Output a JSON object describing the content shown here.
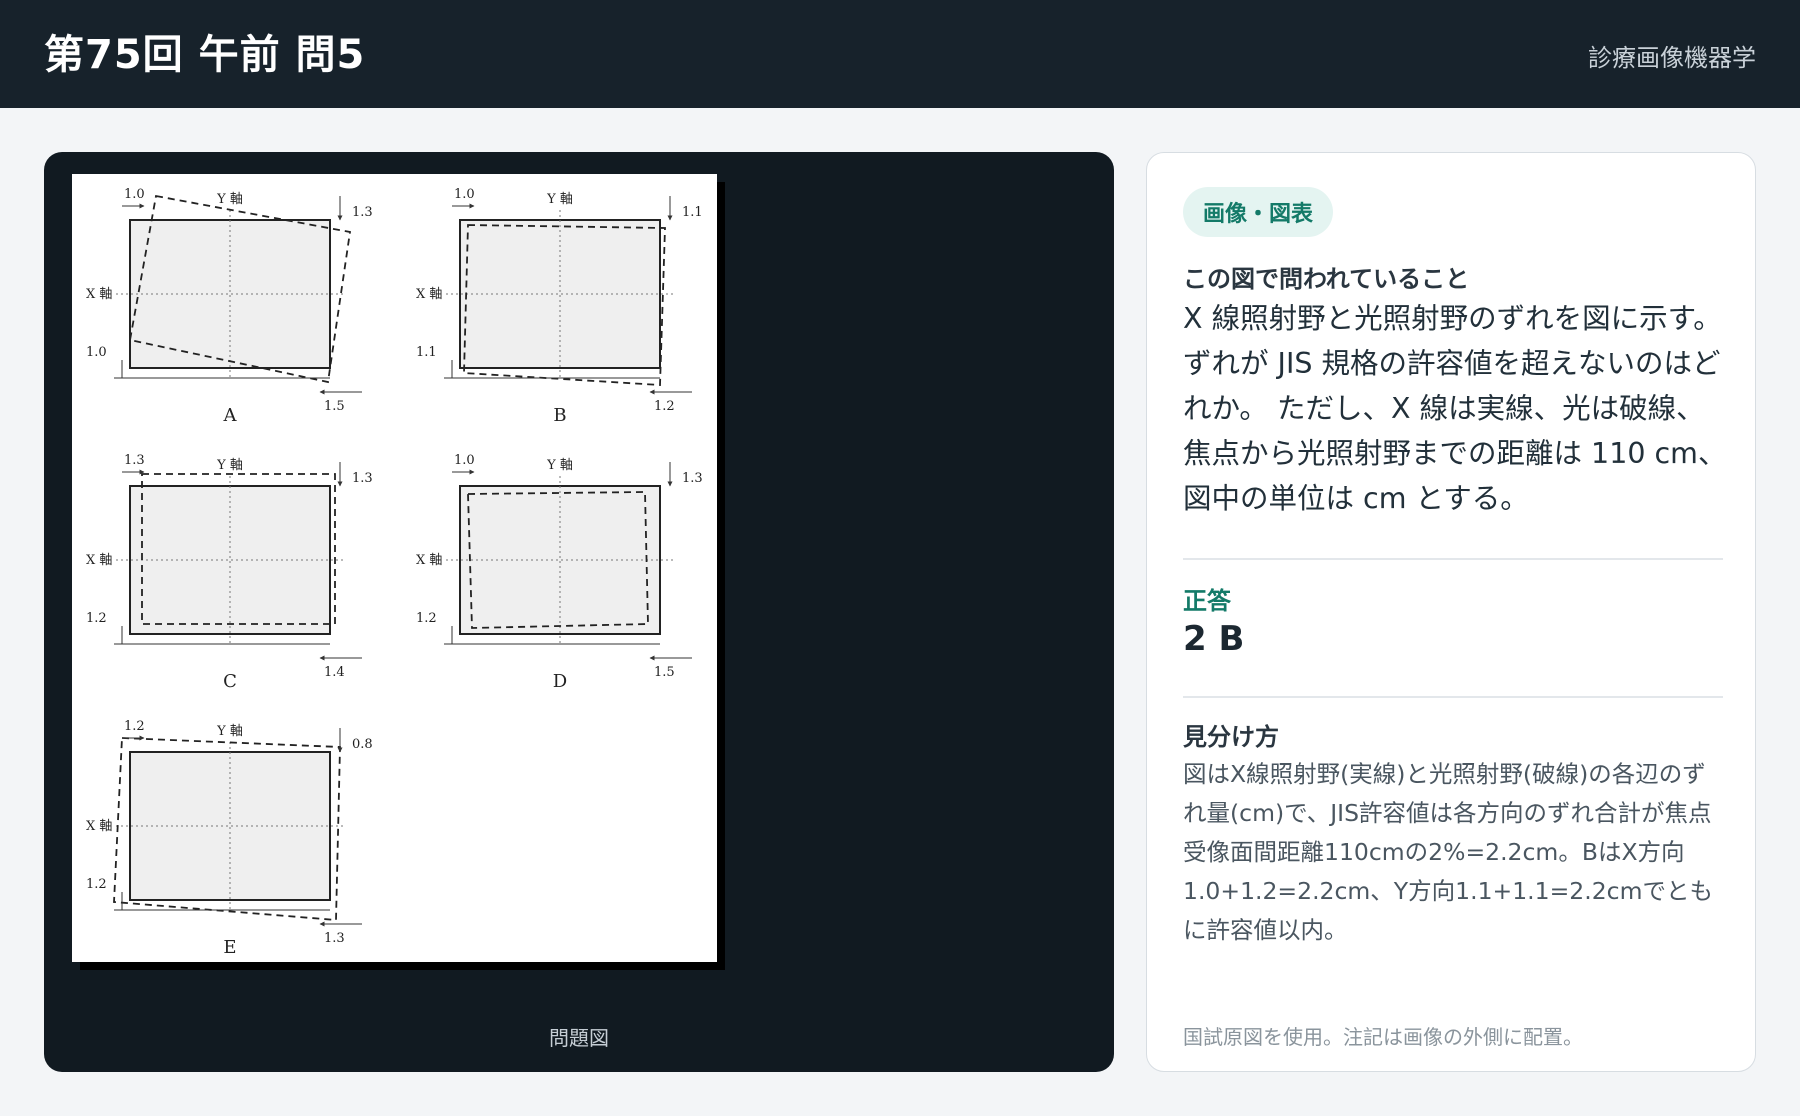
{
  "header": {
    "title": "第75回 午前 問5",
    "subject": "診療画像機器学"
  },
  "figure": {
    "caption": "問題図",
    "axis_x": "X 軸",
    "axis_y": "Y 軸",
    "panels": [
      {
        "id": "A",
        "labels": [
          "1.0",
          "1.3",
          "1.0",
          "1.5"
        ]
      },
      {
        "id": "B",
        "labels": [
          "1.0",
          "1.1",
          "1.1",
          "1.2"
        ]
      },
      {
        "id": "C",
        "labels": [
          "1.3",
          "1.3",
          "1.2",
          "1.4"
        ]
      },
      {
        "id": "D",
        "labels": [
          "1.0",
          "1.3",
          "1.2",
          "1.5"
        ]
      },
      {
        "id": "E",
        "labels": [
          "1.2",
          "0.8",
          "1.2",
          "1.3"
        ]
      }
    ]
  },
  "info": {
    "badge": "画像・図表",
    "question_label": "この図で問われていること",
    "question_text": "X 線照射野と光照射野のずれを図に示す。 ずれが JIS 規格の許容値を超えないのはどれか。 ただし、X 線は実線、光は破線、焦点から光照射野までの距離は 110 cm、図中の単位は cm とする。",
    "answer_label": "正答",
    "answer_value": "2 B",
    "explain_label": "見分け方",
    "explain_text": "図はX線照射野(実線)と光照射野(破線)の各辺のずれ量(cm)で、JIS許容値は各方向のずれ合計が焦点受像面間距離110cmの2%=2.2cm。BはX方向1.0+1.2=2.2cm、Y方向1.1+1.1=2.2cmでともに許容値以内。",
    "footnote": "国試原図を使用。注記は画像の外側に配置。"
  }
}
